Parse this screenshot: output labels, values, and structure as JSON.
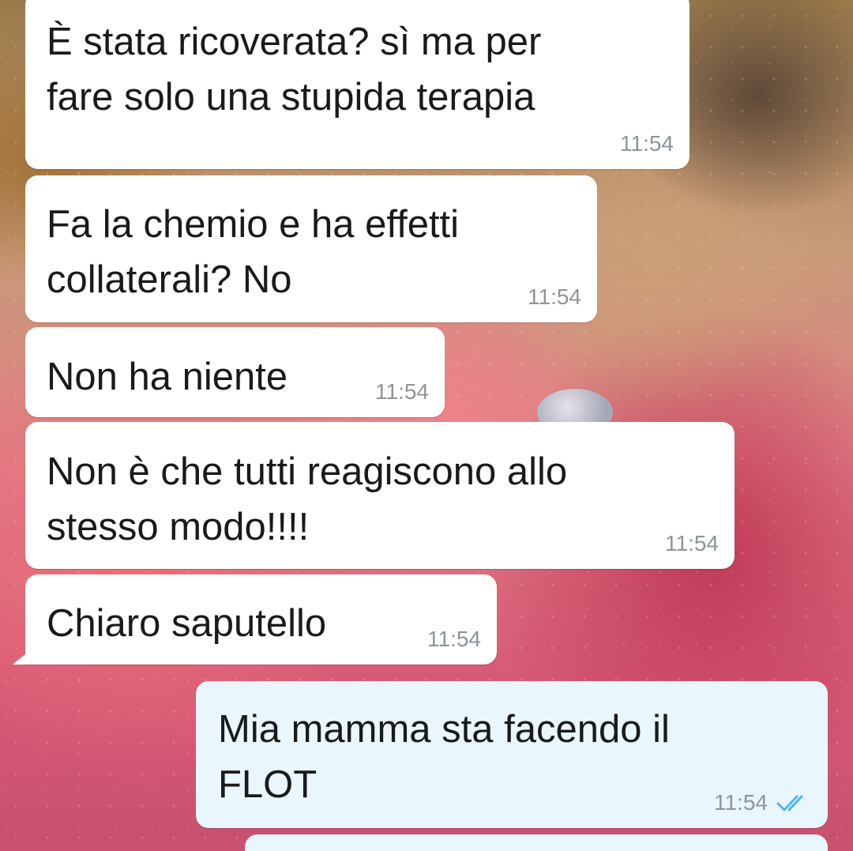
{
  "chat": {
    "messages": [
      {
        "direction": "incoming",
        "text": "È stata ricoverata? sì ma per\nfare solo una stupida terapia",
        "time": "11:54"
      },
      {
        "direction": "incoming",
        "text": "Fa la chemio e ha effetti\ncollaterali? No",
        "time": "11:54"
      },
      {
        "direction": "incoming",
        "text": "Non ha niente",
        "time": "11:54"
      },
      {
        "direction": "incoming",
        "text": "Non è che tutti reagiscono allo\nstesso modo!!!!",
        "time": "11:54"
      },
      {
        "direction": "incoming",
        "text": "Chiaro saputello",
        "time": "11:54"
      },
      {
        "direction": "outgoing",
        "text": "Mia mamma sta facendo il\nFLOT",
        "time": "11:54",
        "status_icon": "double-check-icon",
        "status_color": "#4fb6ec"
      }
    ]
  },
  "colors": {
    "incoming_bubble": "#ffffff",
    "outgoing_bubble": "#e9f6fb",
    "timestamp": "#8e9598",
    "read_ticks": "#4fb6ec"
  }
}
